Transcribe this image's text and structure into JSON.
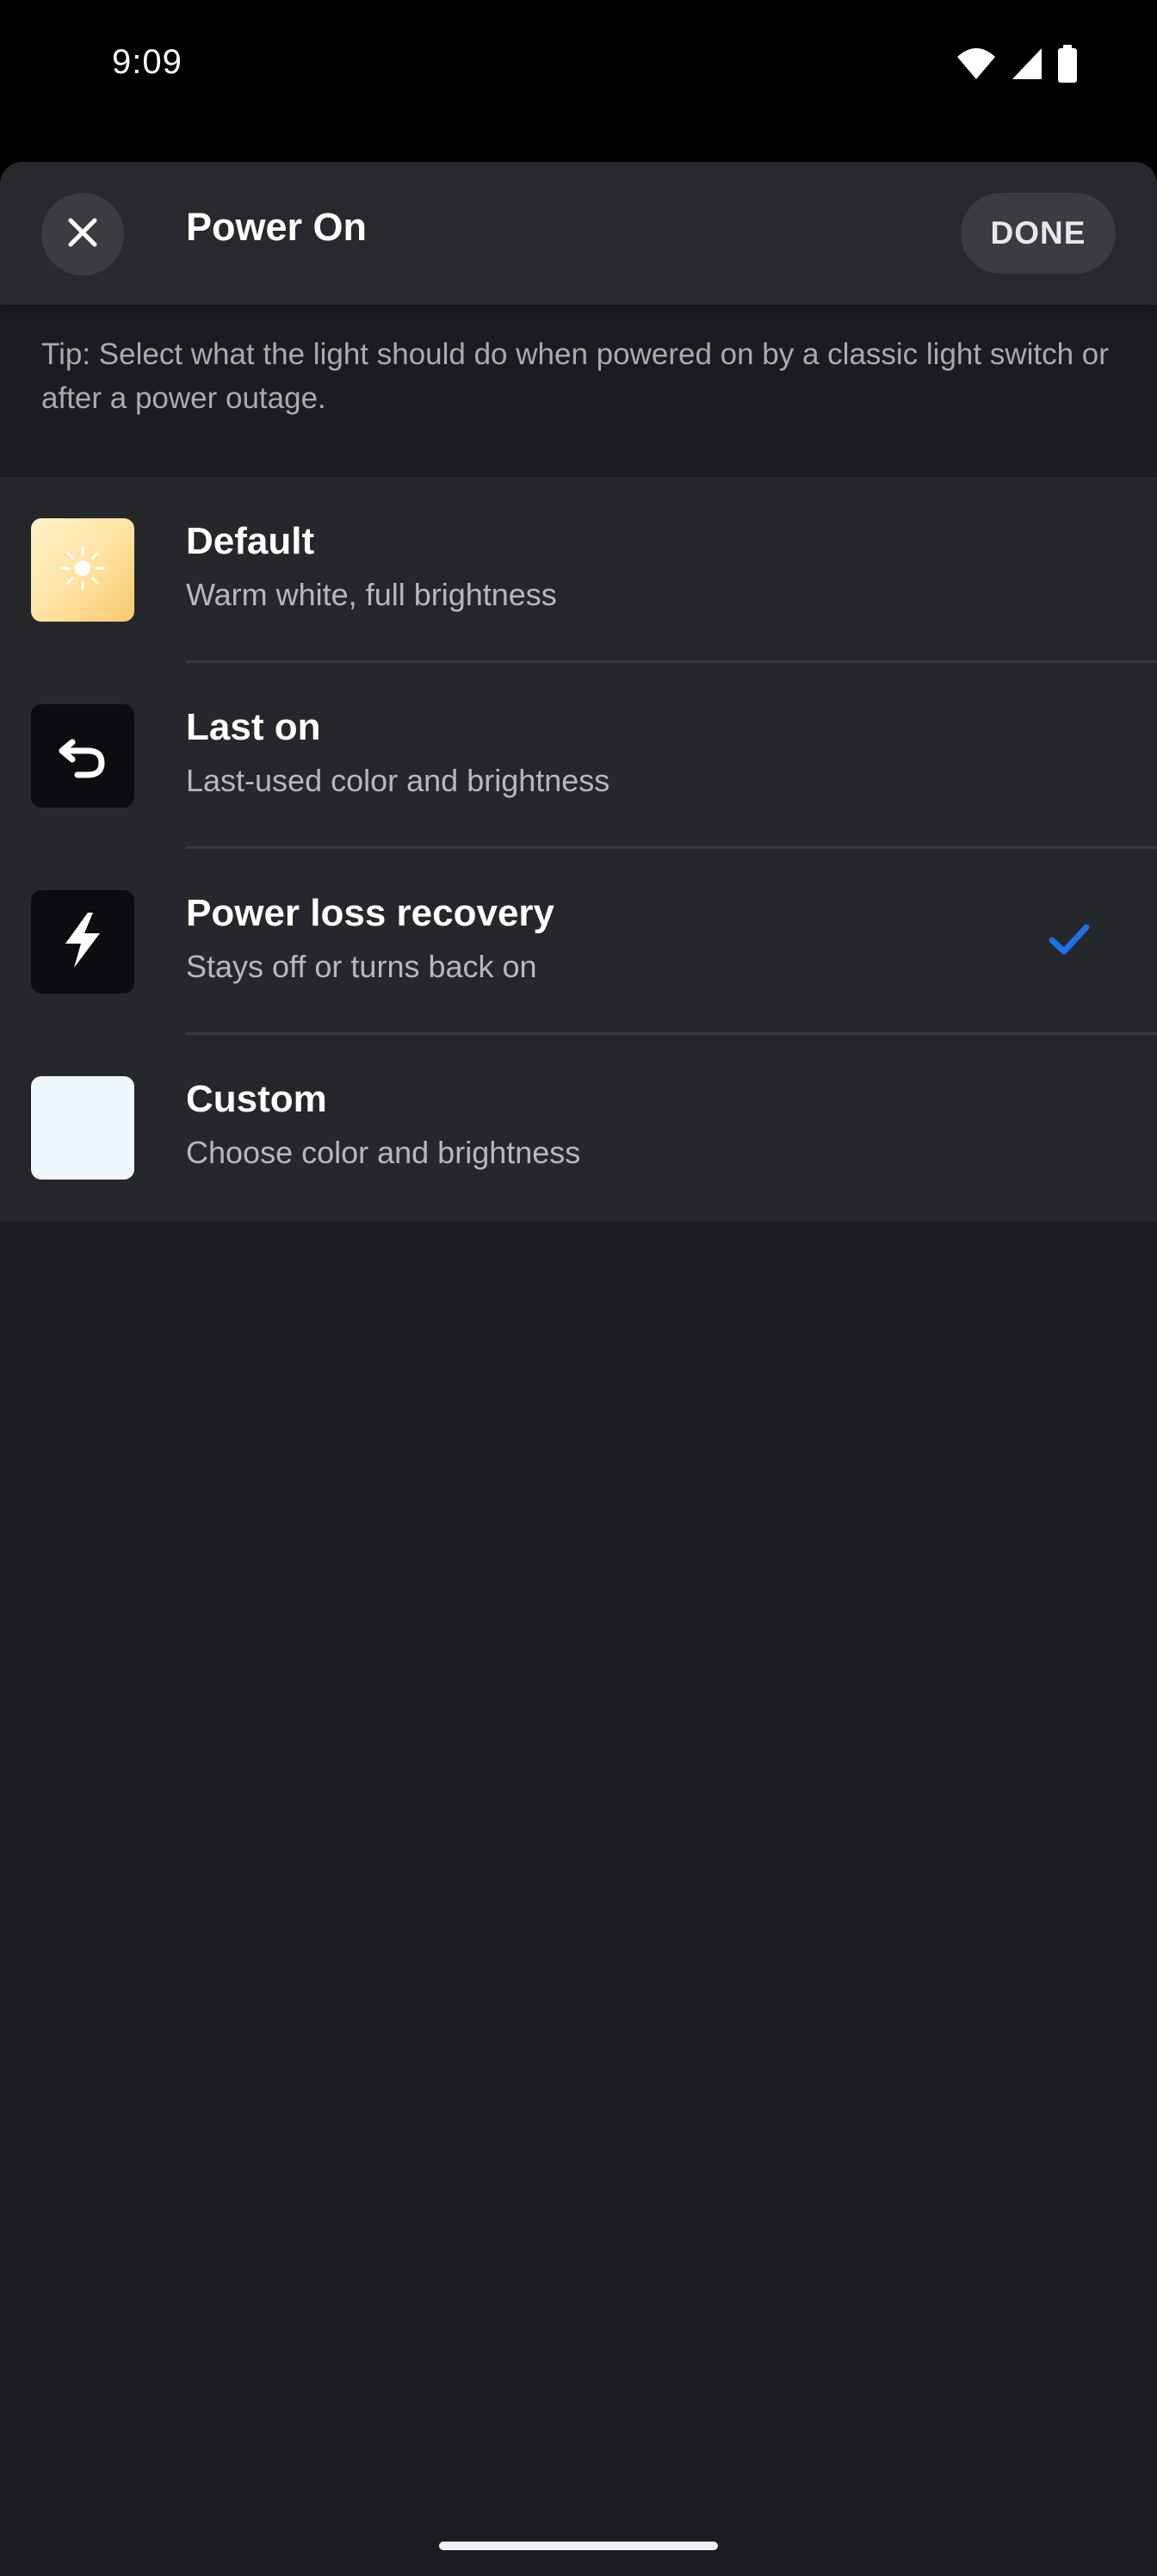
{
  "status_bar": {
    "time": "9:09",
    "icons": [
      "wifi-icon",
      "signal-icon",
      "battery-icon"
    ]
  },
  "header": {
    "close_icon": "close-icon",
    "title": "Power On",
    "done_label": "DONE"
  },
  "tip": "Tip: Select what the light should do when powered on by a classic light switch or after a power outage.",
  "options": [
    {
      "title": "Default",
      "subtitle": "Warm white, full brightness",
      "icon": "sun-icon",
      "selected": false
    },
    {
      "title": "Last on",
      "subtitle": "Last-used color and brightness",
      "icon": "undo-arrow-icon",
      "selected": false
    },
    {
      "title": "Power loss recovery",
      "subtitle": "Stays off or turns back on",
      "icon": "lightning-icon",
      "selected": true
    },
    {
      "title": "Custom",
      "subtitle": "Choose color and brightness",
      "icon": "custom-color-swatch",
      "selected": false
    }
  ],
  "colors": {
    "accent": "#1a73e8",
    "background": "#1a1c20",
    "header": "#27292d",
    "list": "#25272b"
  }
}
